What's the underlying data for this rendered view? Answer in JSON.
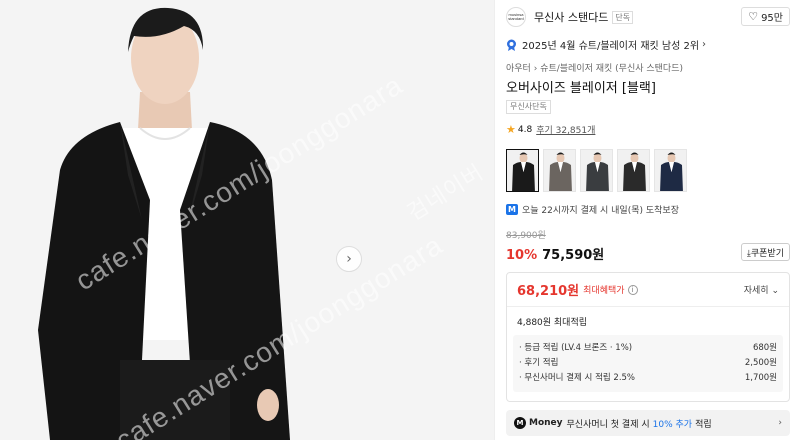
{
  "gallery": {
    "next_arrow": "›",
    "watermarks": [
      "cafe.naver.com/joonggonara",
      "cafe.naver.com/joonggonara",
      "검네이버"
    ]
  },
  "brand": {
    "logo_text": "musinsa standard",
    "name": "무신사 스탠다드",
    "tag": "단독",
    "likes": "95만",
    "heart_icon": "heart-icon"
  },
  "ranking": {
    "text": "2025년 4월 슈트/블레이저 재킷 남성 2위",
    "chevron": "›"
  },
  "product": {
    "category": "아우터 › 슈트/블레이저 재킷 (무신사 스탠다드)",
    "title": "오버사이즈 블레이저 [블랙]",
    "exclusive_tag": "무신사단독",
    "rating": "4.8",
    "review_label": "후기 32,851개"
  },
  "thumbnails": [
    {
      "color": "#1a1a1a",
      "selected": true
    },
    {
      "color": "#6b6560",
      "selected": false
    },
    {
      "color": "#3a3d40",
      "selected": false
    },
    {
      "color": "#2a2a2a",
      "selected": false
    },
    {
      "color": "#1e2a44",
      "selected": false
    }
  ],
  "delivery": {
    "icon": "M",
    "text": "오늘 22시까지 결제 시 내일(목) 도착보장"
  },
  "pricing": {
    "original": "83,900원",
    "discount": "10%",
    "price": "75,590원",
    "coupon_label": "⤓쿠폰받기"
  },
  "benefit": {
    "max_price": "68,210원",
    "max_label": "최대혜택가",
    "info_icon": "i",
    "detail_toggle": "자세히 ⌄",
    "points_total": "4,880원 최대적립",
    "points": [
      {
        "label": "· 등급 적립 (LV.4 브론즈 · 1%)",
        "value": "680원"
      },
      {
        "label": "· 후기 적립",
        "value": "2,500원"
      },
      {
        "label": "· 무신사머니 결제 시 적립 2.5%",
        "value": "1,700원"
      }
    ]
  },
  "money_banner": {
    "logo": "M",
    "brand": "Money",
    "text_a": "무신사머니 첫 결제 시",
    "highlight": "10% 추가",
    "text_b": "적립",
    "chevron": "›"
  },
  "colors": {
    "accent_red": "#e5362e",
    "accent_blue": "#1a73e8"
  }
}
